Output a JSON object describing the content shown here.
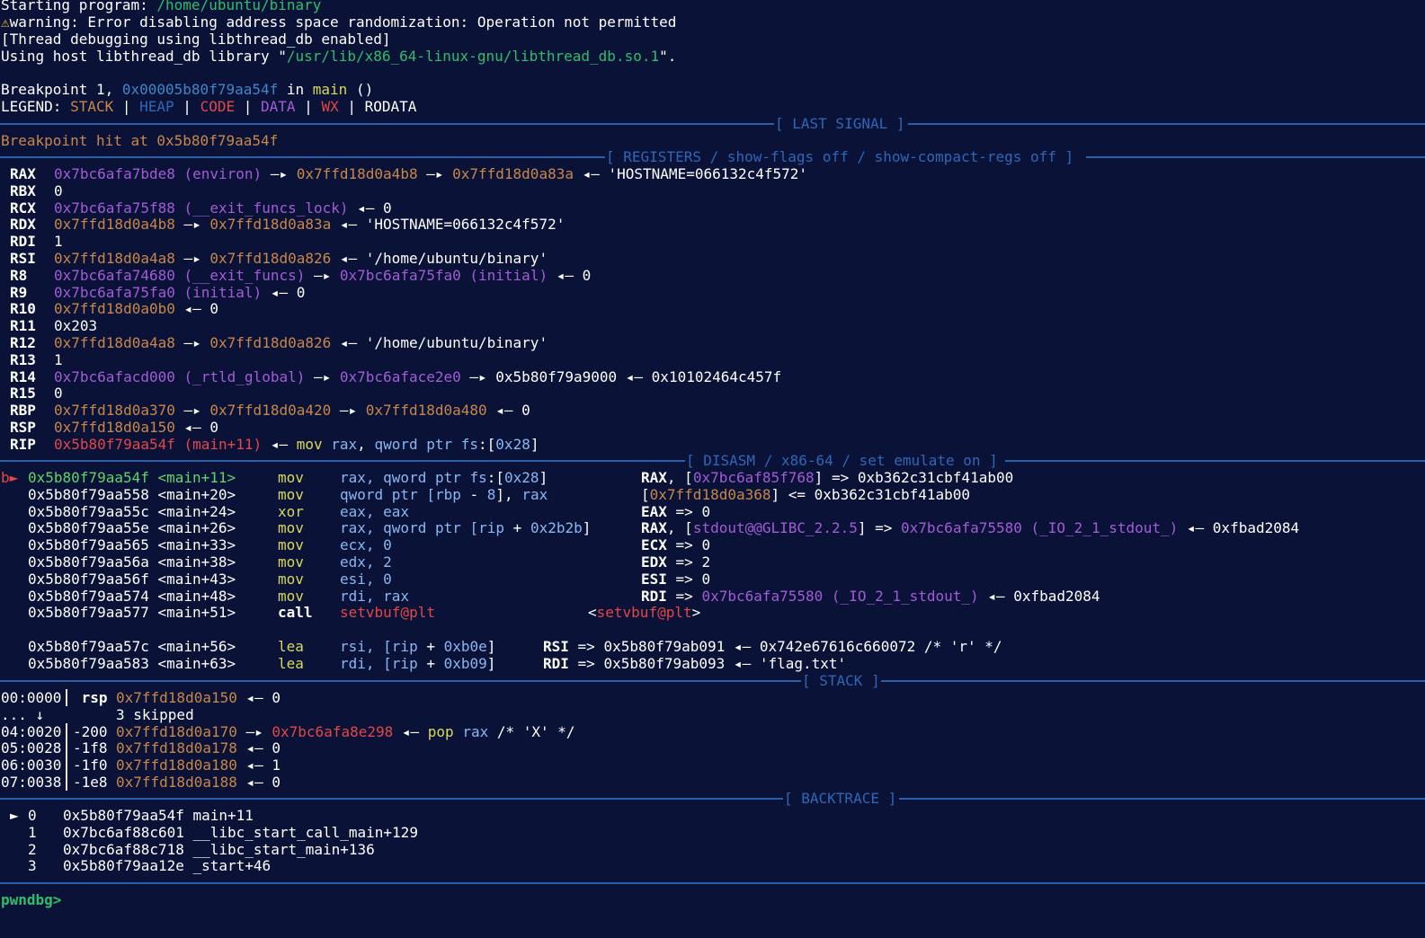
{
  "intro": {
    "starting_label": "Starting program: ",
    "program_path": "/home/ubuntu/binary",
    "warning_icon": "warning-icon",
    "warning_text": "warning: Error disabling address space randomization: Operation not permitted",
    "thread_line": "[Thread debugging using libthread_db enabled]",
    "host_prefix": "Using host libthread_db library \"",
    "host_path": "/usr/lib/x86_64-linux-gnu/libthread_db.so.1",
    "host_suffix": "\".",
    "bp_prefix": "Breakpoint 1, ",
    "bp_addr": "0x00005b80f79aa54f",
    "bp_in": " in ",
    "bp_func": "main",
    "bp_suffix": " ()",
    "legend_label": "LEGEND: ",
    "legend": {
      "stack": "STACK",
      "heap": "HEAP",
      "code": "CODE",
      "data": "DATA",
      "wx": "WX",
      "rodata": "RODATA"
    },
    "sep_bar": " | "
  },
  "sections": {
    "last_signal": "[ LAST SIGNAL ]",
    "registers": "[ REGISTERS / show-flags off / show-compact-regs off ]",
    "disasm": "[ DISASM / x86-64 / set emulate on ]",
    "stack": "[ STACK ]",
    "backtrace": "[ BACKTRACE ]"
  },
  "last_signal_text": "Breakpoint hit at 0x5b80f79aa54f",
  "registers": [
    {
      "name": "RAX",
      "parts": [
        [
          "m",
          "0x7bc6afa7bde8 (environ)"
        ],
        [
          "w",
          " —▸ "
        ],
        [
          "o",
          "0x7ffd18d0a4b8"
        ],
        [
          "w",
          " —▸ "
        ],
        [
          "o",
          "0x7ffd18d0a83a"
        ],
        [
          "w",
          " ◂— 'HOSTNAME=066132c4f572'"
        ]
      ]
    },
    {
      "name": "RBX",
      "parts": [
        [
          "w",
          "0"
        ]
      ]
    },
    {
      "name": "RCX",
      "parts": [
        [
          "m",
          "0x7bc6afa75f88 (__exit_funcs_lock)"
        ],
        [
          "w",
          " ◂— 0"
        ]
      ]
    },
    {
      "name": "RDX",
      "parts": [
        [
          "o",
          "0x7ffd18d0a4b8"
        ],
        [
          "w",
          " —▸ "
        ],
        [
          "o",
          "0x7ffd18d0a83a"
        ],
        [
          "w",
          " ◂— 'HOSTNAME=066132c4f572'"
        ]
      ]
    },
    {
      "name": "RDI",
      "parts": [
        [
          "w",
          "1"
        ]
      ]
    },
    {
      "name": "RSI",
      "parts": [
        [
          "o",
          "0x7ffd18d0a4a8"
        ],
        [
          "w",
          " —▸ "
        ],
        [
          "o",
          "0x7ffd18d0a826"
        ],
        [
          "w",
          " ◂— '/home/ubuntu/binary'"
        ]
      ]
    },
    {
      "name": "R8",
      "parts": [
        [
          "m",
          "0x7bc6afa74680 (__exit_funcs)"
        ],
        [
          "w",
          " —▸ "
        ],
        [
          "m",
          "0x7bc6afa75fa0 (initial)"
        ],
        [
          "w",
          " ◂— 0"
        ]
      ]
    },
    {
      "name": "R9",
      "parts": [
        [
          "m",
          "0x7bc6afa75fa0 (initial)"
        ],
        [
          "w",
          " ◂— 0"
        ]
      ]
    },
    {
      "name": "R10",
      "parts": [
        [
          "o",
          "0x7ffd18d0a0b0"
        ],
        [
          "w",
          " ◂— 0"
        ]
      ]
    },
    {
      "name": "R11",
      "parts": [
        [
          "w",
          "0x203"
        ]
      ]
    },
    {
      "name": "R12",
      "parts": [
        [
          "o",
          "0x7ffd18d0a4a8"
        ],
        [
          "w",
          " —▸ "
        ],
        [
          "o",
          "0x7ffd18d0a826"
        ],
        [
          "w",
          " ◂— '/home/ubuntu/binary'"
        ]
      ]
    },
    {
      "name": "R13",
      "parts": [
        [
          "w",
          "1"
        ]
      ]
    },
    {
      "name": "R14",
      "parts": [
        [
          "m",
          "0x7bc6afacd000 (_rtld_global)"
        ],
        [
          "w",
          " —▸ "
        ],
        [
          "m",
          "0x7bc6aface2e0"
        ],
        [
          "w",
          " —▸ 0x5b80f79a9000 ◂— 0x10102464c457f"
        ]
      ]
    },
    {
      "name": "R15",
      "parts": [
        [
          "w",
          "0"
        ]
      ]
    },
    {
      "name": "RBP",
      "parts": [
        [
          "o",
          "0x7ffd18d0a370"
        ],
        [
          "w",
          " —▸ "
        ],
        [
          "o",
          "0x7ffd18d0a420"
        ],
        [
          "w",
          " —▸ "
        ],
        [
          "o",
          "0x7ffd18d0a480"
        ],
        [
          "w",
          " ◂— 0"
        ]
      ]
    },
    {
      "name": "RSP",
      "parts": [
        [
          "o",
          "0x7ffd18d0a150"
        ],
        [
          "w",
          " ◂— 0"
        ]
      ]
    },
    {
      "name": "RIP",
      "parts": [
        [
          "r",
          "0x5b80f79aa54f (main+11)"
        ],
        [
          "w",
          " ◂— "
        ],
        [
          "y",
          "mov"
        ],
        [
          "w",
          " "
        ],
        [
          "lb",
          "rax"
        ],
        [
          "w",
          ", "
        ],
        [
          "lb",
          "qword ptr fs"
        ],
        [
          "w",
          ":["
        ],
        [
          "lb",
          "0x28"
        ],
        [
          "w",
          "]"
        ]
      ]
    }
  ],
  "disasm": [
    {
      "marker": "b►",
      "addr": "0x5b80f79aa54f <main+11>",
      "current": true,
      "mn": "mov",
      "ops": [
        [
          "lb",
          "rax, qword ptr fs"
        ],
        [
          "w",
          ":["
        ],
        [
          "lb",
          "0x28"
        ],
        [
          "w",
          "]"
        ]
      ],
      "ann_col": 713,
      "ann": [
        [
          "b",
          "RAX"
        ],
        [
          "w",
          ", ["
        ],
        [
          "m",
          "0x7bc6af85f768"
        ],
        [
          "w",
          "] => 0xb362c31cbf41ab00"
        ]
      ]
    },
    {
      "marker": "",
      "addr": "0x5b80f79aa558 <main+20>",
      "mn": "mov",
      "ops": [
        [
          "lb",
          "qword ptr ["
        ],
        [
          "lb",
          "rbp"
        ],
        [
          "w",
          " - "
        ],
        [
          "lb",
          "8"
        ],
        [
          "w",
          "], "
        ],
        [
          "lb",
          "rax"
        ]
      ],
      "ann_col": 713,
      "ann": [
        [
          "w",
          "["
        ],
        [
          "o",
          "0x7ffd18d0a368"
        ],
        [
          "w",
          "] <= 0xb362c31cbf41ab00"
        ]
      ]
    },
    {
      "marker": "",
      "addr": "0x5b80f79aa55c <main+24>",
      "mn": "xor",
      "ops": [
        [
          "lb",
          "eax, eax"
        ]
      ],
      "ann_col": 713,
      "ann": [
        [
          "b",
          "EAX"
        ],
        [
          "w",
          " => 0"
        ]
      ]
    },
    {
      "marker": "",
      "addr": "0x5b80f79aa55e <main+26>",
      "mn": "mov",
      "ops": [
        [
          "lb",
          "rax, qword ptr ["
        ],
        [
          "lb",
          "rip"
        ],
        [
          "w",
          " + "
        ],
        [
          "lb",
          "0x2b2b"
        ],
        [
          "w",
          "]"
        ]
      ],
      "ann_col": 713,
      "ann": [
        [
          "b",
          "RAX"
        ],
        [
          "w",
          ", ["
        ],
        [
          "m",
          "stdout@@GLIBC_2.2.5"
        ],
        [
          "w",
          "] => "
        ],
        [
          "m",
          "0x7bc6afa75580 (_IO_2_1_stdout_)"
        ],
        [
          "w",
          " ◂— 0xfbad2084"
        ]
      ]
    },
    {
      "marker": "",
      "addr": "0x5b80f79aa565 <main+33>",
      "mn": "mov",
      "ops": [
        [
          "lb",
          "ecx, "
        ],
        [
          "lb",
          "0"
        ]
      ],
      "ann_col": 713,
      "ann": [
        [
          "b",
          "ECX"
        ],
        [
          "w",
          " => 0"
        ]
      ]
    },
    {
      "marker": "",
      "addr": "0x5b80f79aa56a <main+38>",
      "mn": "mov",
      "ops": [
        [
          "lb",
          "edx, "
        ],
        [
          "lb",
          "2"
        ]
      ],
      "ann_col": 713,
      "ann": [
        [
          "b",
          "EDX"
        ],
        [
          "w",
          " => 2"
        ]
      ]
    },
    {
      "marker": "",
      "addr": "0x5b80f79aa56f <main+43>",
      "mn": "mov",
      "ops": [
        [
          "lb",
          "esi, "
        ],
        [
          "lb",
          "0"
        ]
      ],
      "ann_col": 713,
      "ann": [
        [
          "b",
          "ESI"
        ],
        [
          "w",
          " => 0"
        ]
      ]
    },
    {
      "marker": "",
      "addr": "0x5b80f79aa574 <main+48>",
      "mn": "mov",
      "ops": [
        [
          "lb",
          "rdi, rax"
        ]
      ],
      "ann_col": 713,
      "ann": [
        [
          "b",
          "RDI"
        ],
        [
          "w",
          " => "
        ],
        [
          "m",
          "0x7bc6afa75580 (_IO_2_1_stdout_)"
        ],
        [
          "w",
          " ◂— 0xfbad2084"
        ]
      ]
    },
    {
      "marker": "",
      "addr": "0x5b80f79aa577 <main+51>",
      "mn": "call",
      "call": true,
      "ops": [
        [
          "r",
          "setvbuf@plt"
        ]
      ],
      "ann_col": 654,
      "ann": [
        [
          "w",
          "<"
        ],
        [
          "r",
          "setvbuf@plt"
        ],
        [
          "w",
          ">"
        ]
      ]
    },
    {
      "blank": true
    },
    {
      "marker": "",
      "addr": "0x5b80f79aa57c <main+56>",
      "mn": "lea",
      "ops": [
        [
          "lb",
          "rsi, ["
        ],
        [
          "lb",
          "rip"
        ],
        [
          "w",
          " + "
        ],
        [
          "lb",
          "0xb0e"
        ],
        [
          "w",
          "]"
        ]
      ],
      "ann_col": 604,
      "ann": [
        [
          "b",
          "RSI"
        ],
        [
          "w",
          " => 0x5b80f79ab091 ◂— 0x742e67616c660072 /* 'r' */"
        ]
      ]
    },
    {
      "marker": "",
      "addr": "0x5b80f79aa583 <main+63>",
      "mn": "lea",
      "ops": [
        [
          "lb",
          "rdi, ["
        ],
        [
          "lb",
          "rip"
        ],
        [
          "w",
          " + "
        ],
        [
          "lb",
          "0xb09"
        ],
        [
          "w",
          "]"
        ]
      ],
      "ann_col": 604,
      "ann": [
        [
          "b",
          "RDI"
        ],
        [
          "w",
          " => 0x5b80f79ab093 ◂— 'flag.txt'"
        ]
      ]
    }
  ],
  "stack": [
    {
      "idx": "00:0000",
      "off": " rsp",
      "bold": true,
      "parts": [
        [
          "o",
          "0x7ffd18d0a150"
        ],
        [
          "w",
          " ◂— 0"
        ]
      ]
    },
    {
      "idx": "... ↓",
      "off": "",
      "skip": "3 skipped",
      "parts": []
    },
    {
      "idx": "04:0020",
      "off": "-200",
      "parts": [
        [
          "o",
          "0x7ffd18d0a170"
        ],
        [
          "w",
          " —▸ "
        ],
        [
          "r",
          "0x7bc6afa8e298"
        ],
        [
          "w",
          " ◂— "
        ],
        [
          "y",
          "pop"
        ],
        [
          "w",
          " "
        ],
        [
          "lb",
          "rax"
        ],
        [
          "w",
          " /* 'X' */"
        ]
      ]
    },
    {
      "idx": "05:0028",
      "off": "-1f8",
      "parts": [
        [
          "o",
          "0x7ffd18d0a178"
        ],
        [
          "w",
          " ◂— 0"
        ]
      ]
    },
    {
      "idx": "06:0030",
      "off": "-1f0",
      "parts": [
        [
          "o",
          "0x7ffd18d0a180"
        ],
        [
          "w",
          " ◂— 1"
        ]
      ]
    },
    {
      "idx": "07:0038",
      "off": "-1e8",
      "parts": [
        [
          "o",
          "0x7ffd18d0a188"
        ],
        [
          "w",
          " ◂— 0"
        ]
      ]
    }
  ],
  "backtrace": [
    {
      "marker": "►",
      "num": "0",
      "text": "0x5b80f79aa54f main+11"
    },
    {
      "marker": "",
      "num": "1",
      "text": "0x7bc6af88c601 __libc_start_call_main+129"
    },
    {
      "marker": "",
      "num": "2",
      "text": "0x7bc6af88c718 __libc_start_main+136"
    },
    {
      "marker": "",
      "num": "3",
      "text": "0x5b80f79aa12e _start+46"
    }
  ],
  "prompt": "pwndbg>"
}
